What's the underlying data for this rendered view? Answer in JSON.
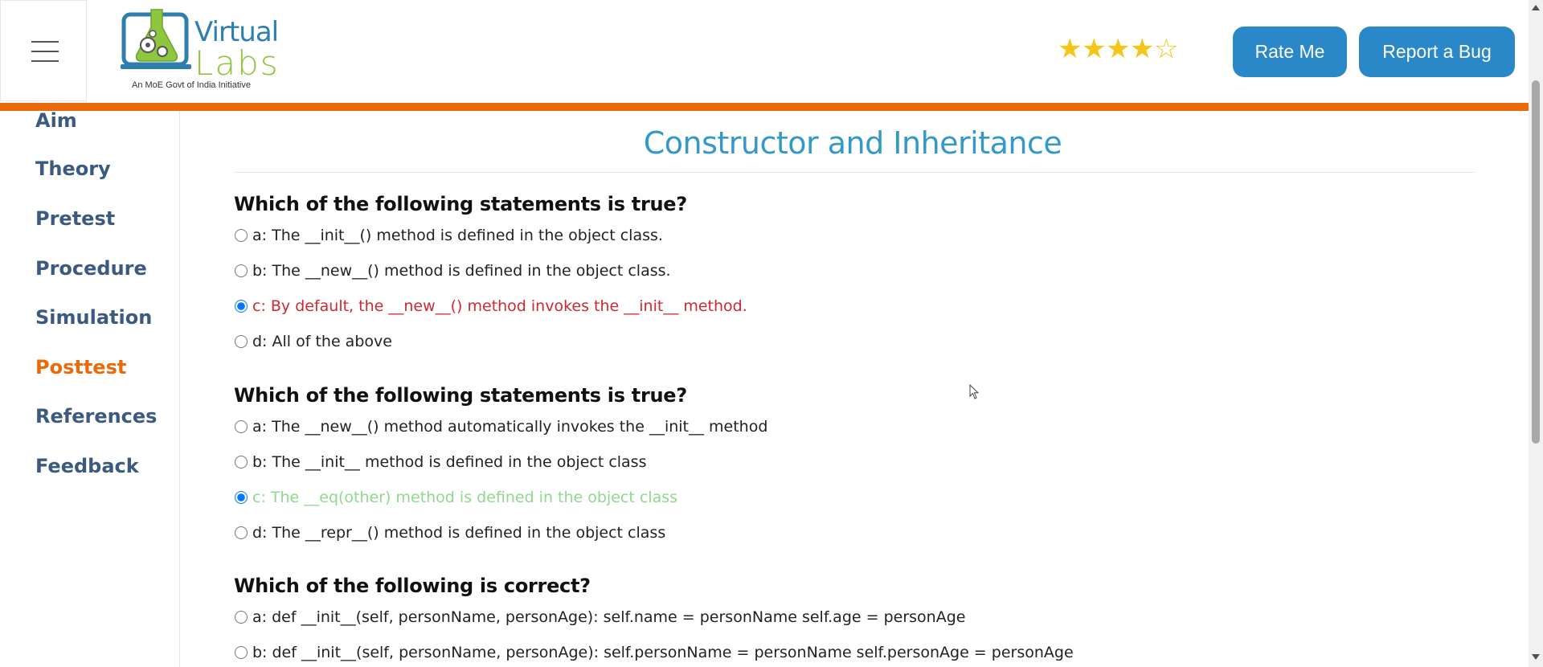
{
  "header": {
    "logo": {
      "word1": "Virtual",
      "word2": "Labs",
      "tagline": "An MoE Govt of India Initiative"
    },
    "rating": {
      "value": 4,
      "max": 5
    },
    "rate_button": "Rate Me",
    "bug_button": "Report a Bug"
  },
  "sidebar": {
    "items": [
      {
        "label": "Aim",
        "active": false
      },
      {
        "label": "Theory",
        "active": false
      },
      {
        "label": "Pretest",
        "active": false
      },
      {
        "label": "Procedure",
        "active": false
      },
      {
        "label": "Simulation",
        "active": false
      },
      {
        "label": "Posttest",
        "active": true
      },
      {
        "label": "References",
        "active": false
      },
      {
        "label": "Feedback",
        "active": false
      }
    ]
  },
  "main": {
    "title": "Constructor and Inheritance",
    "questions": [
      {
        "text": "Which of the following statements is true?",
        "options": [
          {
            "label": "a: The __init__() method is defined in the object class.",
            "checked": false,
            "state": "normal"
          },
          {
            "label": "b: The __new__() method is defined in the object class.",
            "checked": false,
            "state": "normal"
          },
          {
            "label": "c: By default, the __new__() method invokes the __init__ method.",
            "checked": true,
            "state": "wrong"
          },
          {
            "label": "d: All of the above",
            "checked": false,
            "state": "normal"
          }
        ]
      },
      {
        "text": "Which of the following statements is true?",
        "options": [
          {
            "label": "a: The __new__() method automatically invokes the __init__ method",
            "checked": false,
            "state": "normal"
          },
          {
            "label": "b: The __init__ method is defined in the object class",
            "checked": false,
            "state": "normal"
          },
          {
            "label": "c: The __eq(other) method is defined in the object class",
            "checked": true,
            "state": "right"
          },
          {
            "label": "d: The __repr__() method is defined in the object class",
            "checked": false,
            "state": "normal"
          }
        ]
      },
      {
        "text": "Which of the following is correct?",
        "options": [
          {
            "label": "a: def __init__(self, personName, personAge): self.name = personName self.age = personAge",
            "checked": false,
            "state": "normal"
          },
          {
            "label": "b: def __init__(self, personName, personAge): self.personName = personName self.personAge = personAge",
            "checked": false,
            "state": "normal"
          }
        ]
      }
    ]
  },
  "colors": {
    "accent_orange": "#ea6a0a",
    "button_blue": "#2a87c8",
    "title_blue": "#3498c8",
    "nav_text": "#3c5a80",
    "wrong_answer": "#d0282f",
    "right_answer": "#8fd98f",
    "star": "#f5c518"
  },
  "icons": {
    "menu": "hamburger-icon",
    "logo": "flask-gears-logo",
    "star_full": "star-filled-icon",
    "star_empty": "star-outline-icon"
  }
}
